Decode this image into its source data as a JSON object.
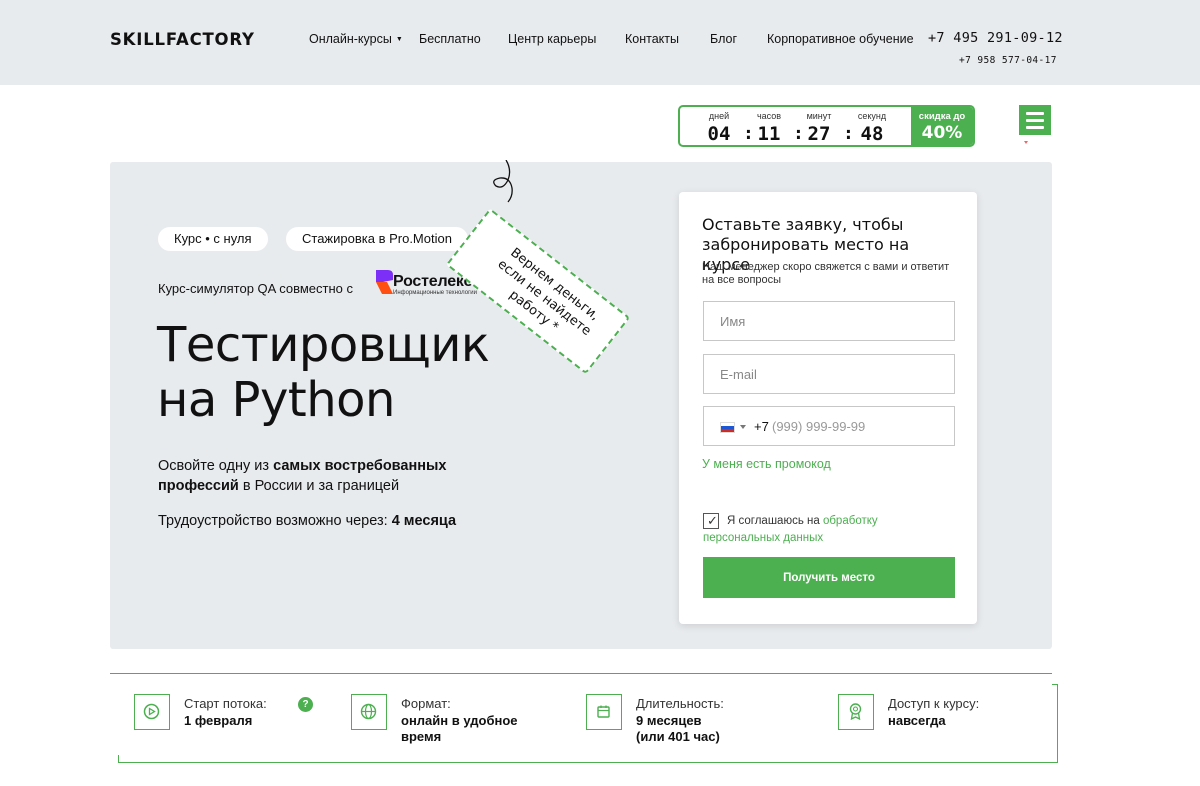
{
  "header": {
    "logo": "SKILLFACTORY",
    "nav": [
      {
        "label": "Онлайн-курсы",
        "has_dropdown": true
      },
      {
        "label": "Бесплатно"
      },
      {
        "label": "Центр карьеры"
      },
      {
        "label": "Контакты"
      },
      {
        "label": "Блог"
      },
      {
        "label": "Корпоративное обучение"
      }
    ],
    "phone_main": "+7 495 291-09-12",
    "phone_secondary": "+7 958 577-04-17"
  },
  "countdown": {
    "units": [
      {
        "label": "дней",
        "value": "04"
      },
      {
        "label": "часов",
        "value": "11"
      },
      {
        "label": "минут",
        "value": "27"
      },
      {
        "label": "секунд",
        "value": "48"
      }
    ],
    "separator": ":",
    "discount_label": "скидка до",
    "discount_value": "40%",
    "accent": "#4caf50"
  },
  "hero": {
    "pills": [
      "Курс • с нуля",
      "Стажировка в Pro.Motion"
    ],
    "partner_text": "Курс-симулятор QA  совместно с",
    "partner_name": "Ростелеком",
    "partner_sub": "Информационные технологии",
    "title_line1": "Тестировщик",
    "title_line2": "на Python",
    "desc_1": "Освойте одну из ",
    "desc_bold": "самых востребованных профессий",
    "desc_2": " в России и за границей",
    "job_text": "Трудоустройство возможно через: ",
    "job_bold": "4 месяца",
    "tag_text": "Вернем деньги, если не найдете работу *"
  },
  "form": {
    "title": "Оставьте заявку, чтобы забронировать место на курсе",
    "subtitle": "Наш менеджер скоро свяжется с вами и ответит на все вопросы",
    "name_placeholder": "Имя",
    "email_placeholder": "E-mail",
    "phone_prefix": "+7",
    "phone_placeholder": "(999) 999-99-99",
    "promo_link": "У меня есть промокод",
    "consent_text": "Я соглашаюсь на ",
    "consent_link": "обработку персональных данных",
    "checkbox_checked": true,
    "submit_label": "Получить место"
  },
  "info": [
    {
      "icon": "play-icon",
      "label": "Старт потока:",
      "value": "1 февраля",
      "value2": "",
      "help": "?"
    },
    {
      "icon": "globe-icon",
      "label": "Формат:",
      "value": "онлайн в удобное",
      "value2": "время"
    },
    {
      "icon": "calendar-icon",
      "label": "Длительность:",
      "value": "9 месяцев",
      "value2": "(или 401 час)"
    },
    {
      "icon": "award-icon",
      "label": "Доступ к курсу:",
      "value": "навсегда",
      "value2": ""
    }
  ]
}
